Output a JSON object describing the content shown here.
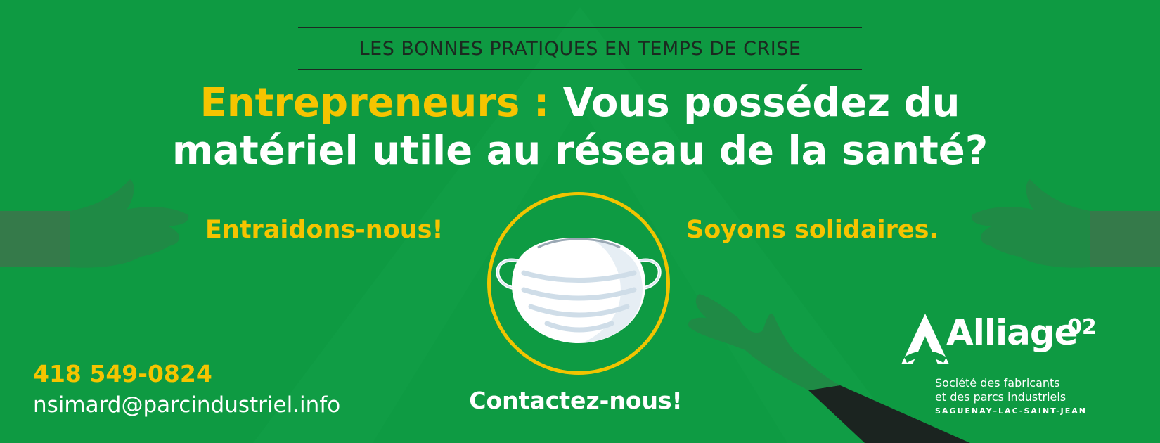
{
  "banner": {
    "kicker": "LES BONNES PRATIQUES EN TEMPS DE CRISE",
    "headline": {
      "accent": "Entrepreneurs :",
      "line1": "Vous possédez du",
      "line2": "matériel utile au réseau de la santé?"
    },
    "left_slogan": "Entraidons-nous!",
    "right_slogan": "Soyons solidaires.",
    "cta": "Contactez-nous!"
  },
  "contact": {
    "phone": "418 549-0824",
    "email": "nsimard@parcindustriel.info"
  },
  "logo": {
    "name": "Alliage",
    "superscript": "02",
    "tagline_line1": "Société des fabricants",
    "tagline_line2": "et des parcs industriels",
    "region": "SAGUENAY–LAC-SAINT-JEAN"
  },
  "icons": [
    "face-mask-icon",
    "hand-left-icon",
    "hand-right-icon",
    "hand-bottom-icon",
    "alliage-logo-icon"
  ],
  "colors": {
    "background": "#0e9a42",
    "accent_yellow": "#f5c400",
    "text_white": "#ffffff",
    "kicker_dark": "#1b2a20"
  }
}
